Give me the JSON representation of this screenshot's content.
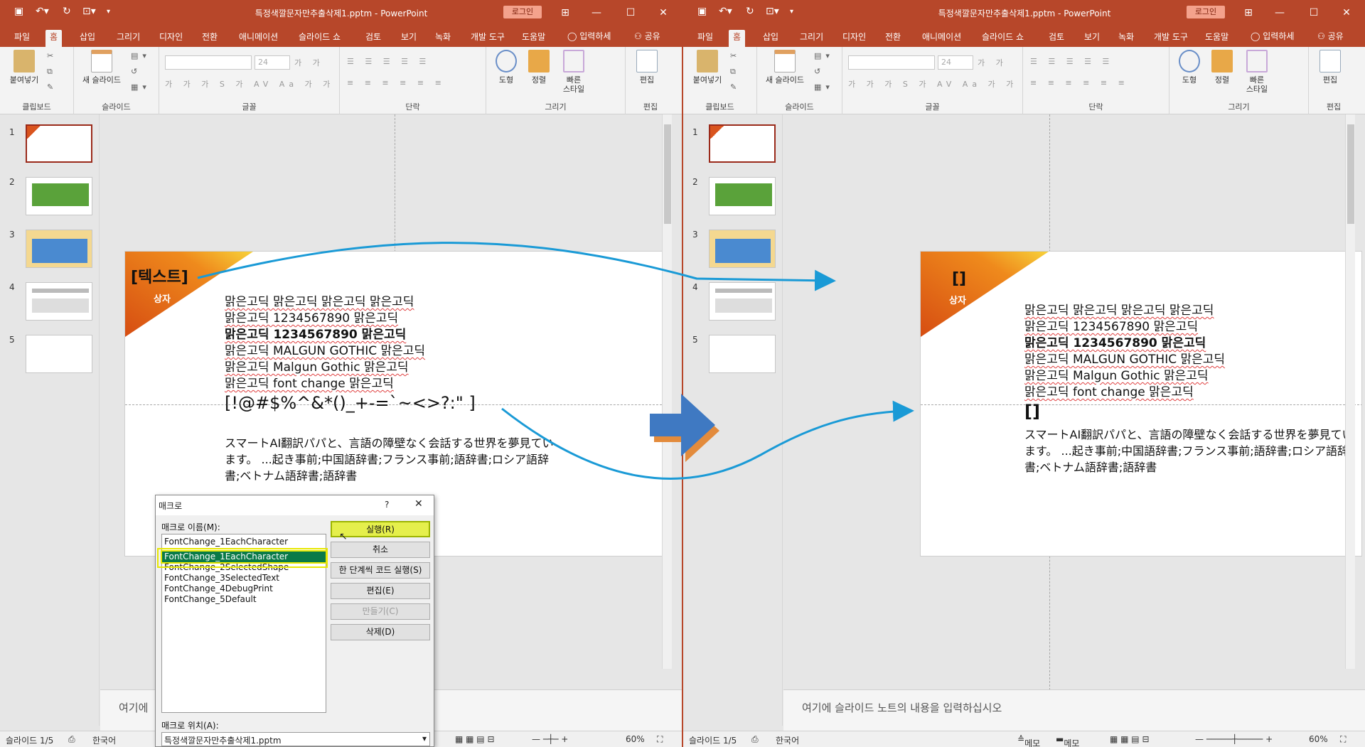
{
  "app": {
    "window_title": "특정색깔문자만추출삭제1.pptm - PowerPoint",
    "login_label": "로그인",
    "tell_me": "입력하세",
    "share": "공유"
  },
  "tabs": [
    "파일",
    "홈",
    "삽입",
    "그리기",
    "디자인",
    "전환",
    "애니메이션",
    "슬라이드 쇼",
    "검토",
    "보기",
    "녹화",
    "개발 도구",
    "도움말"
  ],
  "ribbon": {
    "paste": "붙여넣기",
    "new_slide": "새 슬라이드",
    "font_size": "24",
    "groups": [
      "클립보드",
      "슬라이드",
      "글꼴",
      "단락",
      "그리기",
      "편집"
    ],
    "shapes": "도형",
    "arrange": "정렬",
    "quick_styles_1": "빠른",
    "quick_styles_2": "스타일",
    "edit": "편집"
  },
  "thumb_numbers": [
    "1",
    "2",
    "3",
    "4",
    "5"
  ],
  "slide": {
    "box_text_before": "[텍스트]",
    "box_text_after": "[]",
    "box_sub": "상자",
    "lines": [
      "맑은고딕 맑은고딕 맑은고딕 맑은고딕",
      "맑은고딕 1234567890 맑은고딕",
      "맑은고딕 1234567890 맑은고딕",
      "맑은고딕 MALGUN GOTHIC 맑은고딕",
      "맑은고딕 Malgun Gothic 맑은고딕",
      "맑은고딕 font change 맑은고딕"
    ],
    "symbols_before": "[!@#$%^&*()_+-=`~<>?:\" ]",
    "symbols_after": "[]",
    "japanese": "スマートAI翻訳パパと、言語の障壁なく会話する世界を夢見ています。 ...起き事前;中国語辞書;フランス事前;語辞書;ロシア語辞書;ベトナム語辞書;語辞書"
  },
  "notes": {
    "left": "여기에",
    "right": "여기에 슬라이드 노트의 내용을 입력하십시오"
  },
  "status": {
    "slide_counter": "슬라이드 1/5",
    "language": "한국어",
    "notes_btn": "메모",
    "comments_btn": "메모",
    "zoom": "60%"
  },
  "macro_dialog": {
    "title": "매크로",
    "help": "?",
    "name_label": "매크로 이름(M):",
    "name_value": "FontChange_1EachCharacter",
    "macros": [
      "FontChange_1EachCharacter",
      "FontChange_2SelectedShape",
      "FontChange_3SelectedText",
      "FontChange_4DebugPrint",
      "FontChange_5Default"
    ],
    "buttons": {
      "run": "실행(R)",
      "cancel": "취소",
      "step_into": "한 단계씩 코드 실행(S)",
      "edit": "편집(E)",
      "create": "만들기(C)",
      "delete": "삭제(D)"
    },
    "location_label": "매크로 위치(A):",
    "location_value": "특정색깔문자만추출삭제1.pptm"
  },
  "colors": {
    "accent": "#b7472a",
    "highlight": "#e8e800",
    "arrow_blue": "#1a9ad6",
    "big_arrow": "#3f79c2",
    "big_arrow_shadow": "#e38b3c"
  }
}
